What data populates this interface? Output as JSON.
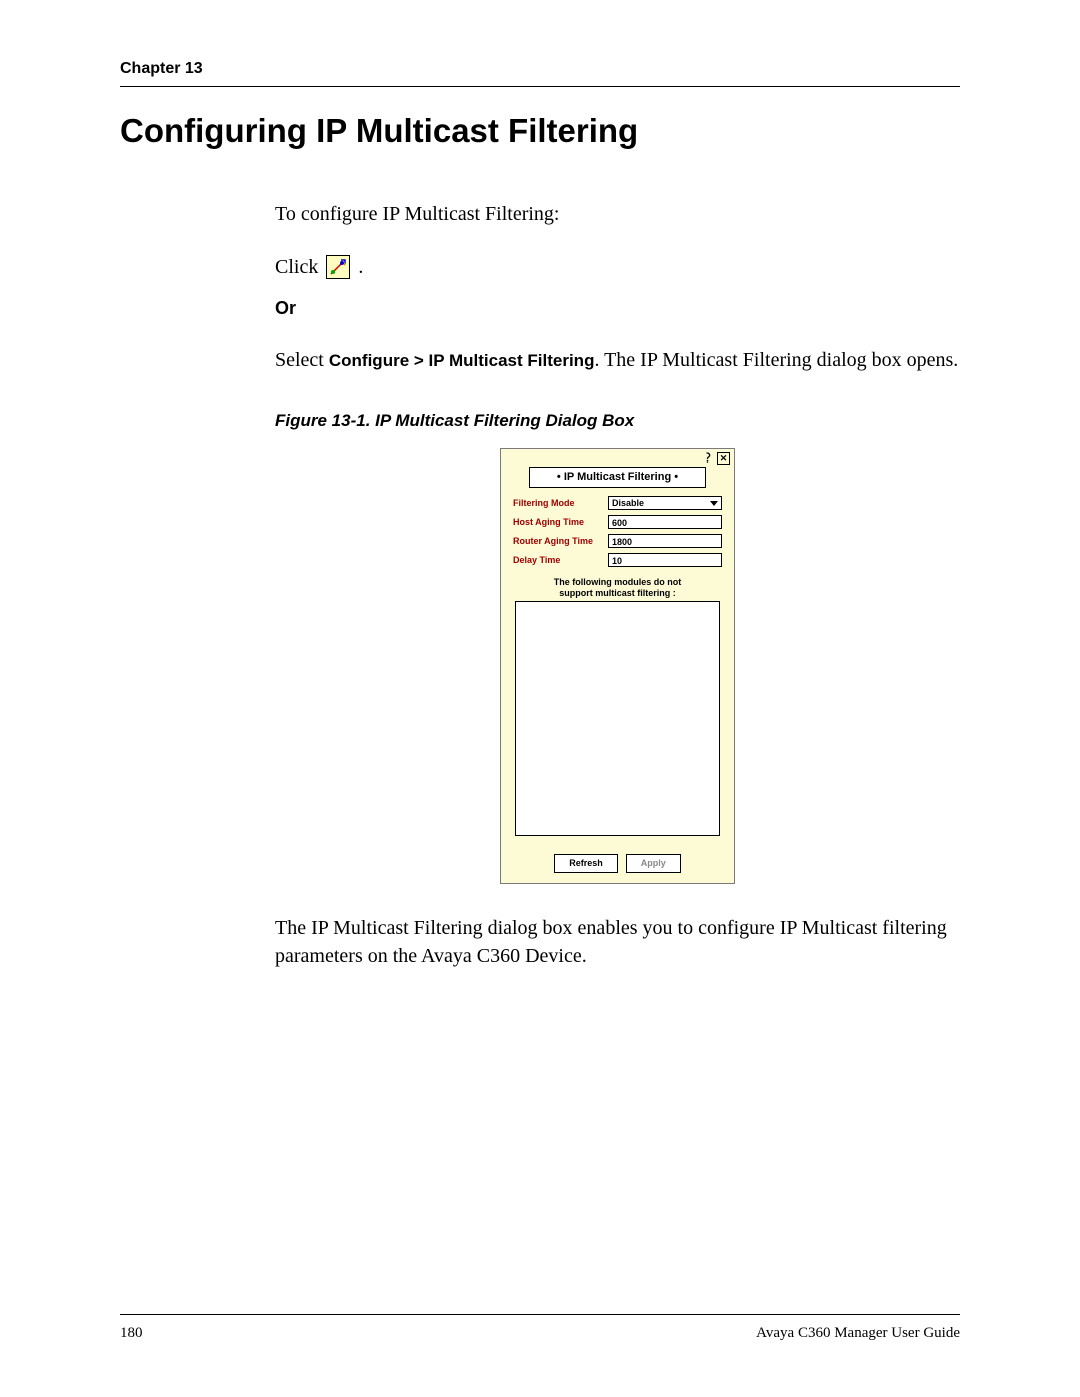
{
  "header": {
    "chapter": "Chapter 13"
  },
  "title": "Configuring IP Multicast Filtering",
  "intro": "To configure IP Multicast Filtering:",
  "click": {
    "prefix": "Click ",
    "suffix": "."
  },
  "or": "Or",
  "select": {
    "prefix": "Select ",
    "menu": "Configure > IP Multicast Filtering",
    "suffix": ". The IP Multicast Filtering dialog box opens."
  },
  "figure_caption": "Figure 13-1.  IP Multicast Filtering Dialog Box",
  "dialog": {
    "title": "• IP Multicast Filtering •",
    "fields": {
      "filtering_mode": {
        "label": "Filtering Mode",
        "value": "Disable"
      },
      "host_aging": {
        "label": "Host Aging Time",
        "value": "600"
      },
      "router_aging": {
        "label": "Router Aging Time",
        "value": "1800"
      },
      "delay_time": {
        "label": "Delay Time",
        "value": "10"
      }
    },
    "modules_caption_line1": "The following modules do not",
    "modules_caption_line2": "support multicast filtering :",
    "buttons": {
      "refresh": "Refresh",
      "apply": "Apply"
    },
    "close": "✕"
  },
  "after": "The IP Multicast Filtering dialog box enables you to configure IP Multicast filtering parameters on the Avaya C360 Device.",
  "footer": {
    "page": "180",
    "doc": "Avaya C360 Manager User Guide"
  }
}
